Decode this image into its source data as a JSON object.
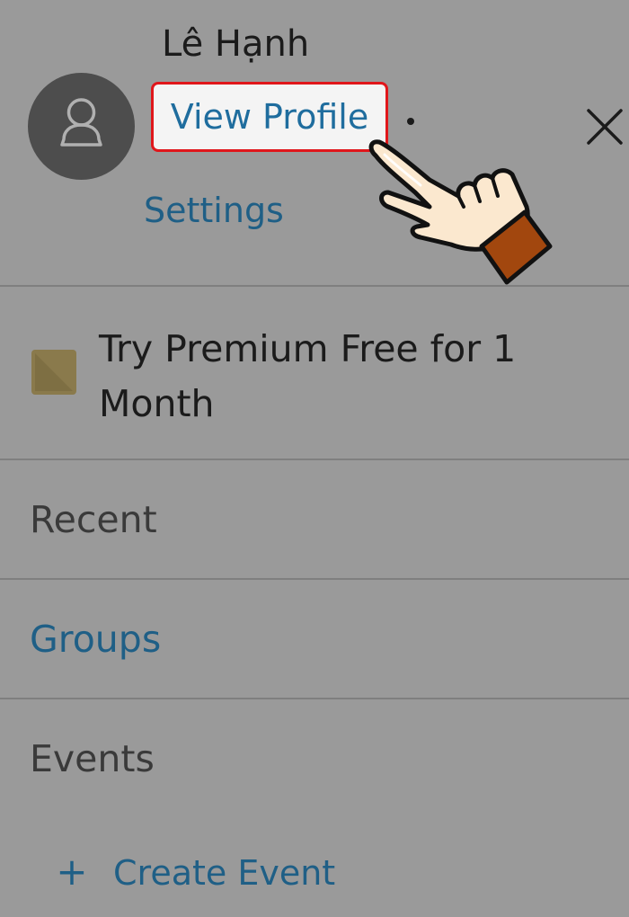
{
  "profile": {
    "name": "Lê Hạnh",
    "view_profile_label": "View Profile",
    "settings_label": "Settings"
  },
  "premium": {
    "label": "Try Premium Free for 1 Month"
  },
  "menu": {
    "recent": "Recent",
    "groups": "Groups",
    "events": "Events",
    "create_event": "Create Event",
    "create_event_icon": "+"
  },
  "colors": {
    "background": "#9a9a9a",
    "link": "#1f6d9e",
    "highlight_border": "#e0161b",
    "avatar": "#4d4d4d"
  }
}
